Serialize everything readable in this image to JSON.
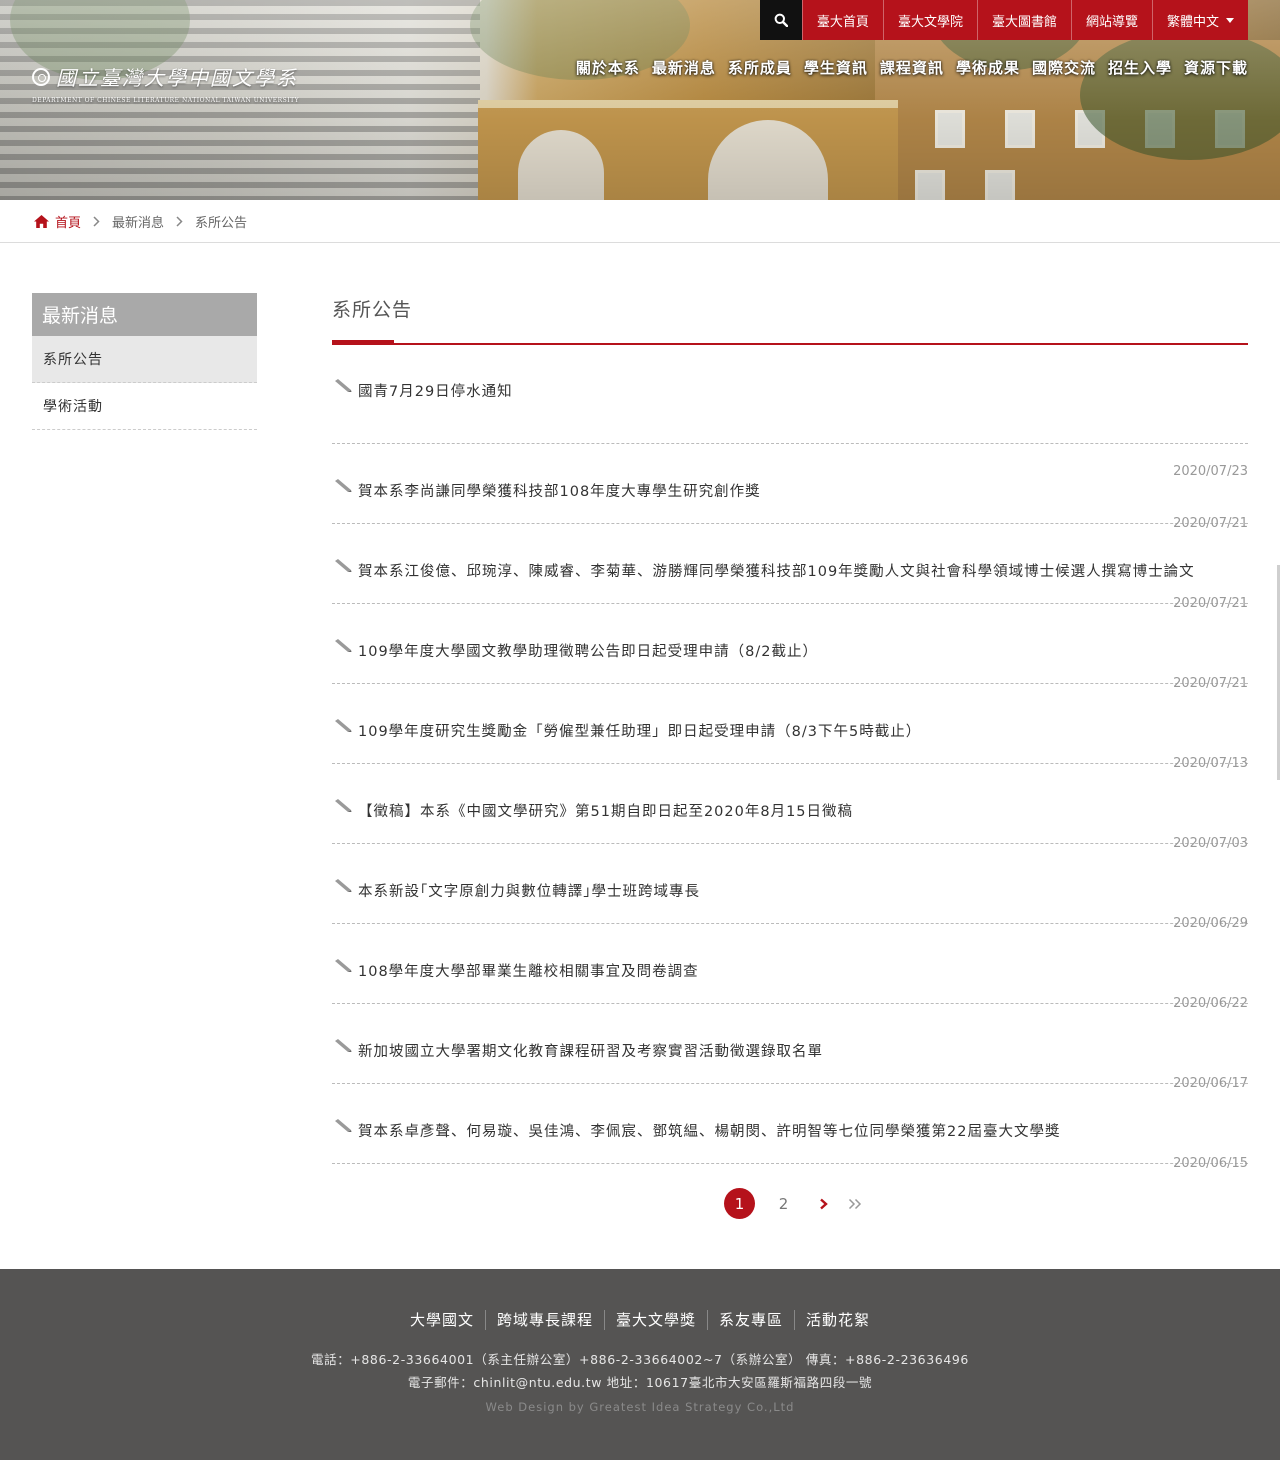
{
  "header": {
    "logo_name": "國立臺灣大學中國文學系",
    "logo_en": "DEPARTMENT OF CHINESE LITERATURE NATIONAL TAIWAN UNIVERSITY",
    "top_links": [
      "臺大首頁",
      "臺大文學院",
      "臺大圖書館",
      "網站導覽"
    ],
    "language": "繁體中文",
    "nav": [
      "關於本系",
      "最新消息",
      "系所成員",
      "學生資訊",
      "課程資訊",
      "學術成果",
      "國際交流",
      "招生入學",
      "資源下載"
    ]
  },
  "breadcrumb": [
    "首頁",
    "最新消息",
    "系所公告"
  ],
  "sidebar": {
    "heading": "最新消息",
    "items": [
      "系所公告",
      "學術活動"
    ]
  },
  "content": {
    "title": "系所公告",
    "announcements": [
      {
        "title": "國青7月29日停水通知",
        "date": "2020/07/23"
      },
      {
        "title": "賀本系李尚謙同學榮獲科技部108年度大專學生研究創作獎",
        "date": "2020/07/21"
      },
      {
        "title": "賀本系江俊億、邱琬淳、陳威睿、李菊華、游勝輝同學榮獲科技部109年獎勵人文與社會科學領域博士候選人撰寫博士論文",
        "date": "2020/07/21"
      },
      {
        "title": "109學年度大學國文教學助理徵聘公告即日起受理申請（8/2截止）",
        "date": "2020/07/21"
      },
      {
        "title": "109學年度研究生獎勵金「勞僱型兼任助理」即日起受理申請（8/3下午5時截止）",
        "date": "2020/07/13"
      },
      {
        "title": "【徵稿】本系《中國文學研究》第51期自即日起至2020年8月15日徵稿",
        "date": "2020/07/03"
      },
      {
        "title": "本系新設｢文字原創力與數位轉譯｣學士班跨域專長",
        "date": "2020/06/29"
      },
      {
        "title": "108學年度大學部畢業生離校相關事宜及問卷調查",
        "date": "2020/06/22"
      },
      {
        "title": "新加坡國立大學署期文化教育課程研習及考察實習活動徵選錄取名單",
        "date": "2020/06/17"
      },
      {
        "title": "賀本系卓彥聲、何易璇、吳佳鴻、李佩宸、鄧筑緼、楊朝閔、許明智等七位同學榮獲第22屆臺大文學獎",
        "date": "2020/06/15"
      }
    ]
  },
  "pagination": {
    "pages": [
      "1",
      "2"
    ],
    "current": "1"
  },
  "footer": {
    "links": [
      "大學國文",
      "跨域專長課程",
      "臺大文學獎",
      "系友專區",
      "活動花絮"
    ],
    "phone_line": "電話：+886-2-33664001（系主任辦公室）+886-2-33664002~7（系辦公室） 傳真：+886-2-23636496",
    "email_line": "電子郵件：chinlit@ntu.edu.tw 地址：10617臺北市大安區羅斯福路四段一號",
    "credit": "Web Design by Greatest Idea Strategy Co.,Ltd"
  },
  "colors": {
    "accent": "#b5121b",
    "footer_bg": "#555453",
    "sidebar_head": "#a9a9a9"
  },
  "icons": [
    "search-icon",
    "home-icon",
    "chevron-right-icon",
    "pencil-icon",
    "double-chevron-right-icon",
    "caret-down-icon"
  ]
}
